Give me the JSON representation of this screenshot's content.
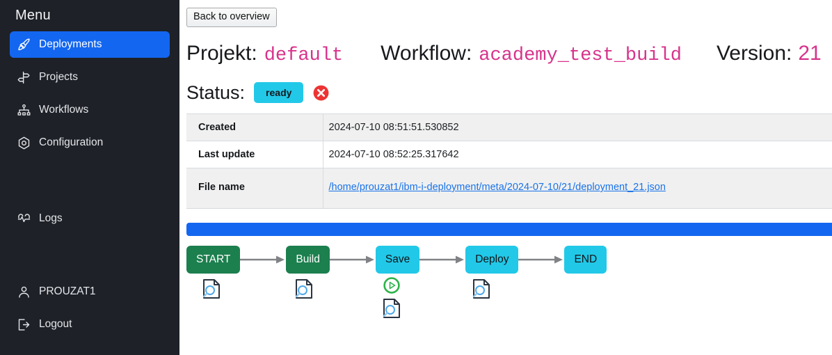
{
  "sidebar": {
    "title": "Menu",
    "items": [
      {
        "label": "Deployments",
        "icon": "rocket-icon",
        "active": true
      },
      {
        "label": "Projects",
        "icon": "signpost-icon",
        "active": false
      },
      {
        "label": "Workflows",
        "icon": "hierarchy-icon",
        "active": false
      },
      {
        "label": "Configuration",
        "icon": "hexagon-gear-icon",
        "active": false
      }
    ],
    "bottom_items": [
      {
        "label": "Logs",
        "icon": "pulse-icon"
      },
      {
        "label": "PROUZAT1",
        "icon": "user-icon"
      },
      {
        "label": "Logout",
        "icon": "logout-icon"
      }
    ]
  },
  "main": {
    "back_button": "Back to overview",
    "header": {
      "project_label": "Projekt:",
      "project_value": "default",
      "workflow_label": "Workflow:",
      "workflow_value": "academy_test_build",
      "version_label": "Version:",
      "version_value": "21"
    },
    "status": {
      "label": "Status:",
      "badge": "ready",
      "badge_color": "#22c8e8",
      "fail_icon": "error-circle-icon",
      "fail_icon_color": "#ee3333"
    },
    "table": {
      "rows": [
        {
          "label": "Created",
          "value": "2024-07-10 08:51:51.530852",
          "is_link": false
        },
        {
          "label": "Last update",
          "value": "2024-07-10 08:52:25.317642",
          "is_link": false
        },
        {
          "label": "File name",
          "value": "/home/prouzat1/ibm-i-deployment/meta/2024-07-10/21/deployment_21.json",
          "is_link": true
        }
      ]
    },
    "progress": {
      "percent": 100,
      "color": "#1366f0"
    },
    "flow": {
      "nodes": [
        {
          "label": "START",
          "color": "green",
          "icons": [
            "doc-search-icon"
          ]
        },
        {
          "label": "Build",
          "color": "green",
          "icons": [
            "doc-search-icon"
          ]
        },
        {
          "label": "Save",
          "color": "cyan",
          "icons": [
            "play-circle-icon",
            "doc-search-icon"
          ]
        },
        {
          "label": "Deploy",
          "color": "cyan",
          "icons": [
            "doc-search-icon"
          ]
        },
        {
          "label": "END",
          "color": "cyan",
          "icons": []
        }
      ],
      "connector_color": "#808285",
      "green_color": "#1c7f4e",
      "cyan_color": "#22c8e8",
      "play_icon_color": "#2eb34a"
    }
  }
}
